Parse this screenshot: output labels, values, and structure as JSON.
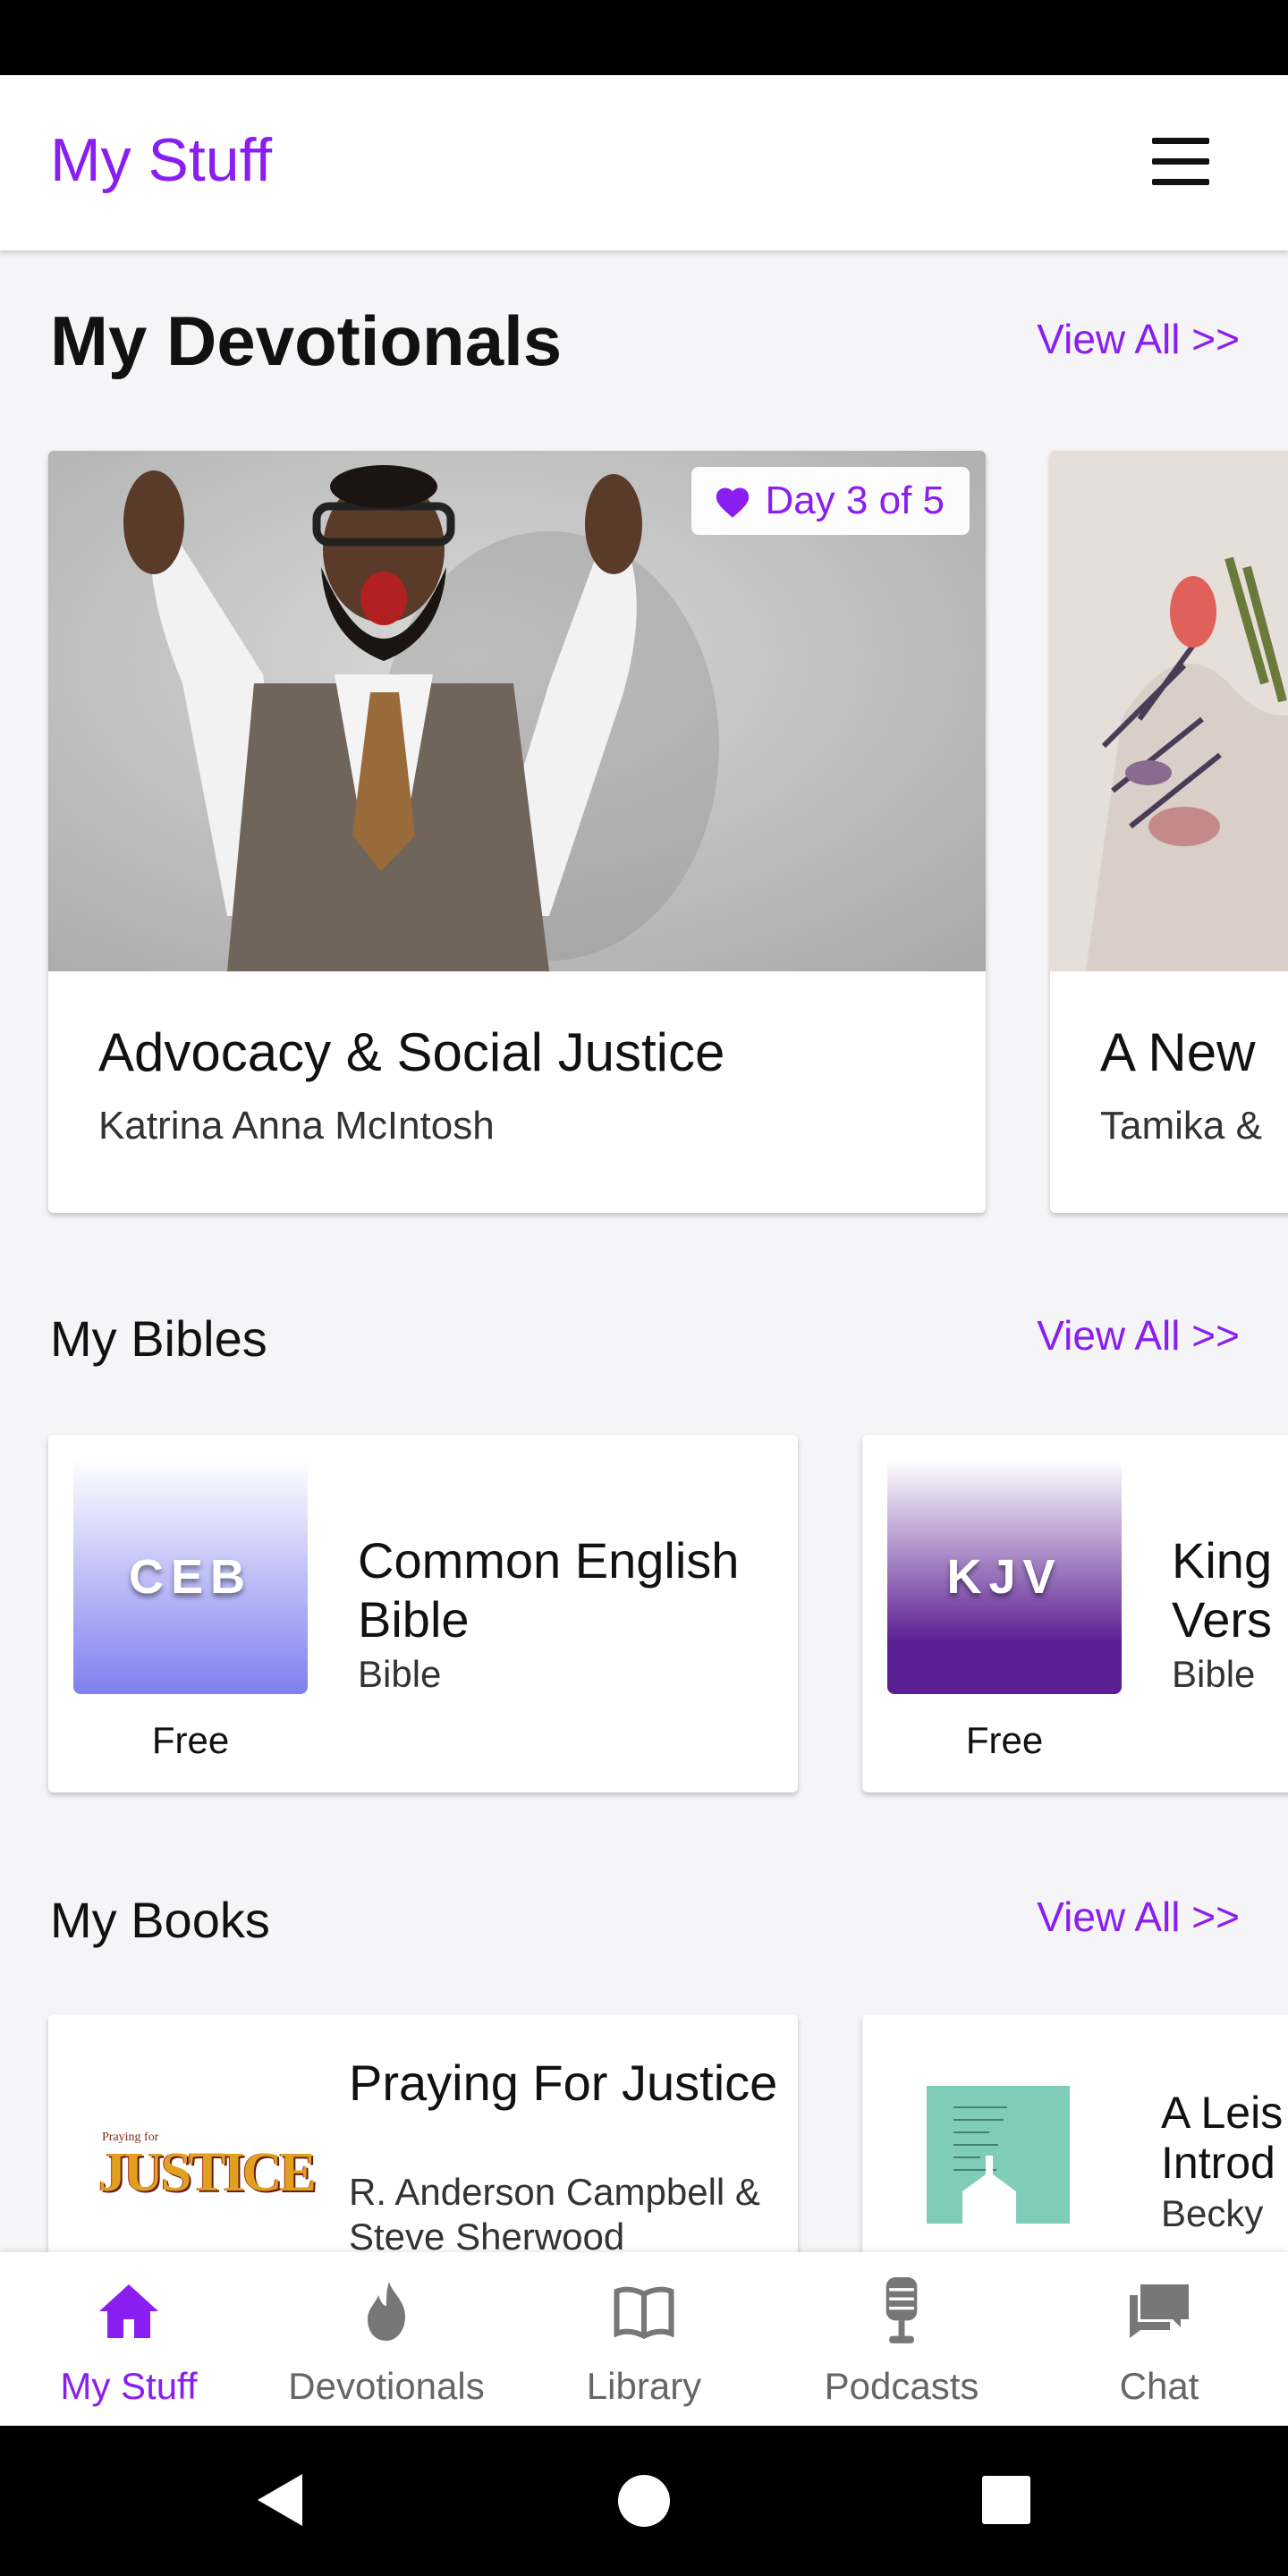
{
  "app_bar": {
    "title": "My Stuff",
    "menu_icon": "hamburger-menu-icon"
  },
  "devotionals": {
    "title": "My Devotionals",
    "view_all": "View All >>",
    "items": [
      {
        "title": "Advocacy & Social Justice",
        "author": "Katrina Anna McIntosh",
        "badge": "Day 3 of 5"
      },
      {
        "title": "A New",
        "author": "Tamika &"
      }
    ]
  },
  "bibles": {
    "title": "My Bibles",
    "view_all": "View All >>",
    "items": [
      {
        "abbr": "CEB",
        "name": "Common English Bible",
        "type": "Bible",
        "price": "Free",
        "color_top": "#ffffff",
        "color_bottom": "#7f7ff0"
      },
      {
        "abbr": "KJV",
        "name": "King James Version",
        "name_visible": "King Vers",
        "type": "Bible",
        "price": "Free",
        "color_top": "#ffffff",
        "color_bottom": "#5c1f93"
      }
    ]
  },
  "books": {
    "title": "My Books",
    "view_all": "View All >>",
    "items": [
      {
        "name": "Praying For Justice",
        "author": "R. Anderson Campbell & Steve Sherwood",
        "cover_text": "JUSTICE",
        "cover_small": "Praying for"
      },
      {
        "name": "A Leis Introd",
        "author": "Becky"
      }
    ]
  },
  "bottom_nav": [
    {
      "label": "My Stuff",
      "icon": "home-icon",
      "active": true
    },
    {
      "label": "Devotionals",
      "icon": "flame-icon",
      "active": false
    },
    {
      "label": "Library",
      "icon": "open-book-icon",
      "active": false
    },
    {
      "label": "Podcasts",
      "icon": "microphone-icon",
      "active": false
    },
    {
      "label": "Chat",
      "icon": "chat-bubbles-icon",
      "active": false
    }
  ],
  "colors": {
    "accent": "#8a1ef0",
    "background": "#f5f5f7",
    "bar": "#000000"
  }
}
